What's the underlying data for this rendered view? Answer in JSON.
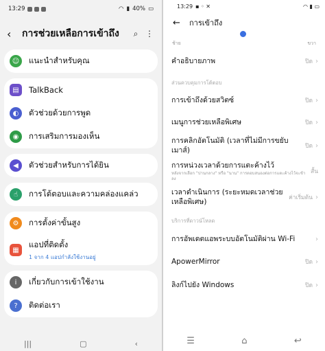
{
  "left": {
    "status": {
      "time": "13:29",
      "battery": "40%"
    },
    "header": {
      "title": "การช่วยเหลือการเข้าถึง"
    },
    "cards": [
      {
        "items": [
          {
            "label": "แนะนำสำหรับคุณ",
            "icon": "person-icon",
            "color": "#3aa64a"
          }
        ]
      },
      {
        "items": [
          {
            "label": "TalkBack",
            "icon": "talkback-icon",
            "color": "#6d4fc9"
          },
          {
            "label": "ตัวช่วยด้วยการพูด",
            "icon": "speech-icon",
            "color": "#4a5fd0"
          },
          {
            "label": "การเสริมการมองเห็น",
            "icon": "vision-icon",
            "color": "#2e9b47"
          }
        ]
      },
      {
        "items": [
          {
            "label": "ตัวช่วยสำหรับการได้ยิน",
            "icon": "hearing-icon",
            "color": "#5a4fd0"
          }
        ]
      },
      {
        "items": [
          {
            "label": "การโต้ตอบและความคล่องแคล่ว",
            "icon": "touch-icon",
            "color": "#2aa06a"
          }
        ]
      },
      {
        "items": [
          {
            "label": "การตั้งค่าขั้นสูง",
            "icon": "advanced-icon",
            "color": "#f08a1c"
          },
          {
            "label": "แอปที่ติดตั้ง",
            "sub": "1 จาก 4 แอปกำลังใช้งานอยู่",
            "icon": "apps-icon",
            "color": "#e8533c"
          }
        ]
      },
      {
        "items": [
          {
            "label": "เกี่ยวกับการเข้าใช้งาน",
            "icon": "info-icon",
            "color": "#666666"
          },
          {
            "label": "ติดต่อเรา",
            "icon": "contact-icon",
            "color": "#4a6fd0"
          }
        ]
      }
    ]
  },
  "right": {
    "status": {
      "time": "13:29"
    },
    "header": {
      "title": "การเข้าถึง"
    },
    "slider": {
      "left_label": "ช้าย",
      "right_label": "ขวา"
    },
    "rows_top": [
      {
        "label": "คำอธิบายภาพ",
        "value": "ปิด"
      }
    ],
    "section1": "ส่วนควบคุมการโต้ตอบ",
    "rows_mid": [
      {
        "label": "การเข้าถึงด้วยสวิตซ์",
        "value": "ปิด"
      },
      {
        "label": "เมนูการช่วยเหลือพิเศษ",
        "value": "ปิด"
      },
      {
        "label": "การคลิกอัตโนมัติ (เวลาที่ไม่มีการขยับเมาส์)",
        "value": "ปิด"
      },
      {
        "label": "การหน่วงเวลาด้วยการแตะค้างไว้",
        "sub": "หลังจากเลือก \"ปานกลาง\" หรือ \"นาน\" การตอบสนองต่อการแตะค้างไว้จะช้าลง",
        "value": "สั้น"
      },
      {
        "label": "เวลาดำเนินการ (ระยะหมดเวลาช่วยเหลือพิเศษ)",
        "value": "ค่าเริ่มต้น"
      }
    ],
    "section2": "บริการที่ดาวน์โหลด",
    "rows_bottom": [
      {
        "label": "การอัพเดตแอพระบบอัตโนมัติผ่าน Wi-Fi",
        "value": ""
      },
      {
        "label": "ApowerMirror",
        "value": "ปิด"
      },
      {
        "label": "ลิงก์ไปยัง Windows",
        "value": "ปิด"
      }
    ]
  }
}
